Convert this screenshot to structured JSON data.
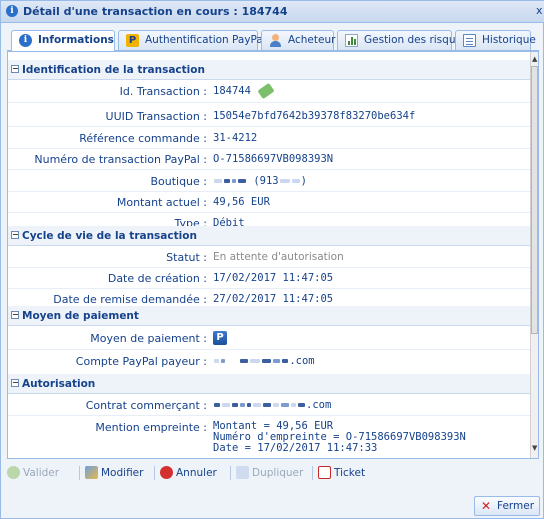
{
  "window": {
    "title": "Détail d'une transaction en cours : 184744",
    "close_glyph": "x"
  },
  "tabs": [
    {
      "label": "Informations",
      "icon": "info-icon",
      "active": true
    },
    {
      "label": "Authentification PayPal",
      "icon": "paypal-icon",
      "active": false
    },
    {
      "label": "Acheteur",
      "icon": "user-icon",
      "active": false
    },
    {
      "label": "Gestion des risques",
      "icon": "chart-icon",
      "active": false
    },
    {
      "label": "Historique",
      "icon": "document-icon",
      "active": false
    }
  ],
  "sections": {
    "identification": {
      "title": "Identification de la transaction",
      "id_label": "Id. Transaction :",
      "id_value": "184744",
      "uuid_label": "UUID Transaction :",
      "uuid_value": "15054e7bfd7642b39378f83270be634f",
      "ref_label": "Référence commande :",
      "ref_value": "31-4212",
      "paypal_label": "Numéro de transaction PayPal :",
      "paypal_value": "O-71586697VB098393N",
      "shop_label": "Boutique :",
      "shop_value_visible": "(913",
      "amount_label": "Montant actuel :",
      "amount_value": "49,56 EUR",
      "type_label": "Type :",
      "type_value": "Débit"
    },
    "lifecycle": {
      "title": "Cycle de vie de la transaction",
      "status_label": "Statut :",
      "status_value": "En attente d'autorisation",
      "created_label": "Date de création :",
      "created_value": "17/02/2017 11:47:05",
      "remise_label": "Date de remise demandée :",
      "remise_value": "27/02/2017 11:47:05"
    },
    "payment": {
      "title": "Moyen de paiement",
      "method_label": "Moyen de paiement :",
      "account_label": "Compte PayPal payeur :",
      "account_suffix": ".com"
    },
    "authorization": {
      "title": "Autorisation",
      "contract_label": "Contrat commerçant :",
      "contract_suffix": ".com",
      "footprint_label": "Mention empreinte :",
      "footprint_value": "Montant = 49,56 EUR\nNuméro d'empreinte = O-71586697VB098393N\nDate = 17/02/2017 11:47:33"
    }
  },
  "toolbar": {
    "validate": "Valider",
    "modify": "Modifier",
    "cancel": "Annuler",
    "duplicate": "Dupliquer",
    "ticket": "Ticket"
  },
  "footer": {
    "close_label": "Fermer"
  },
  "colors": {
    "accent": "#15428b",
    "border": "#99bbe8",
    "header_bg": "#dfe8f6"
  }
}
